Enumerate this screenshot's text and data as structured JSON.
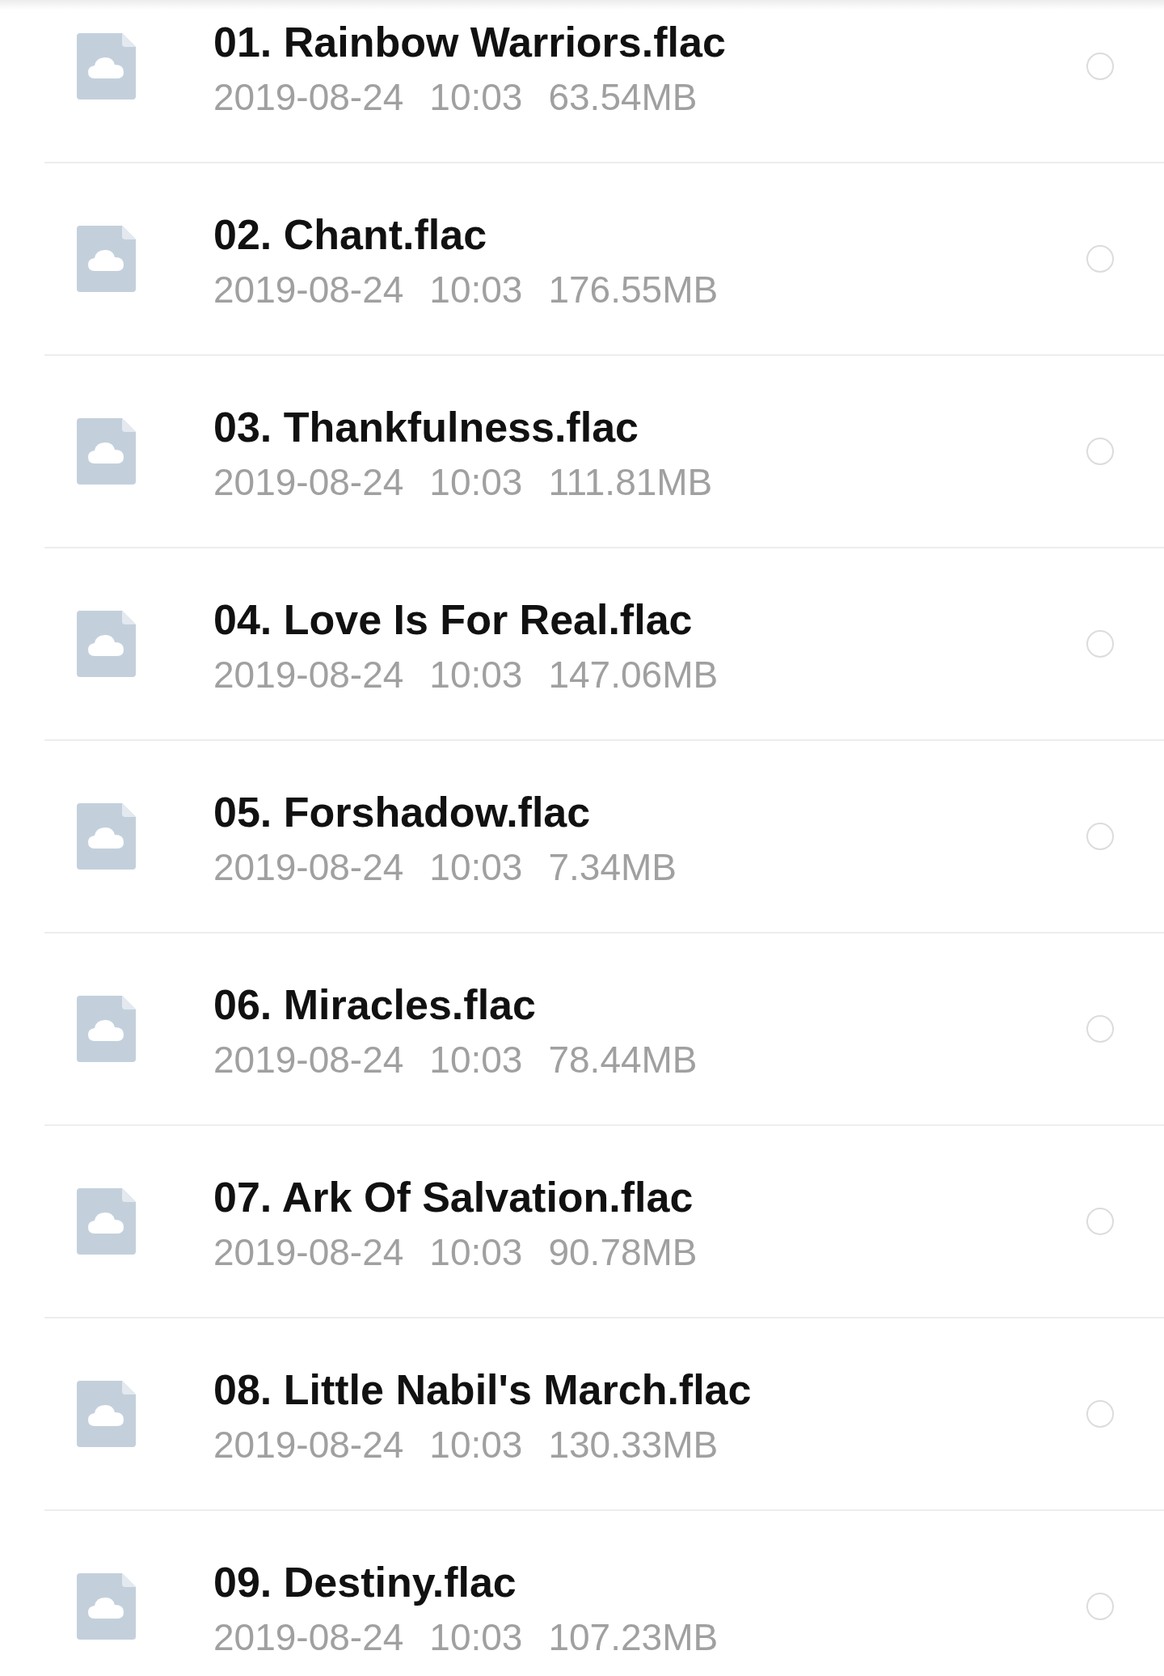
{
  "files": [
    {
      "name": "01. Rainbow Warriors.flac",
      "date": "2019-08-24",
      "time": "10:03",
      "size": "63.54MB",
      "selected": false
    },
    {
      "name": "02. Chant.flac",
      "date": "2019-08-24",
      "time": "10:03",
      "size": "176.55MB",
      "selected": false
    },
    {
      "name": "03. Thankfulness.flac",
      "date": "2019-08-24",
      "time": "10:03",
      "size": "111.81MB",
      "selected": false
    },
    {
      "name": "04. Love Is For Real.flac",
      "date": "2019-08-24",
      "time": "10:03",
      "size": "147.06MB",
      "selected": false
    },
    {
      "name": "05. Forshadow.flac",
      "date": "2019-08-24",
      "time": "10:03",
      "size": "7.34MB",
      "selected": false
    },
    {
      "name": "06. Miracles.flac",
      "date": "2019-08-24",
      "time": "10:03",
      "size": "78.44MB",
      "selected": false
    },
    {
      "name": "07. Ark Of Salvation.flac",
      "date": "2019-08-24",
      "time": "10:03",
      "size": "90.78MB",
      "selected": false
    },
    {
      "name": "08. Little Nabil's March.flac",
      "date": "2019-08-24",
      "time": "10:03",
      "size": "130.33MB",
      "selected": false
    },
    {
      "name": "09. Destiny.flac",
      "date": "2019-08-24",
      "time": "10:03",
      "size": "107.23MB",
      "selected": false
    }
  ]
}
